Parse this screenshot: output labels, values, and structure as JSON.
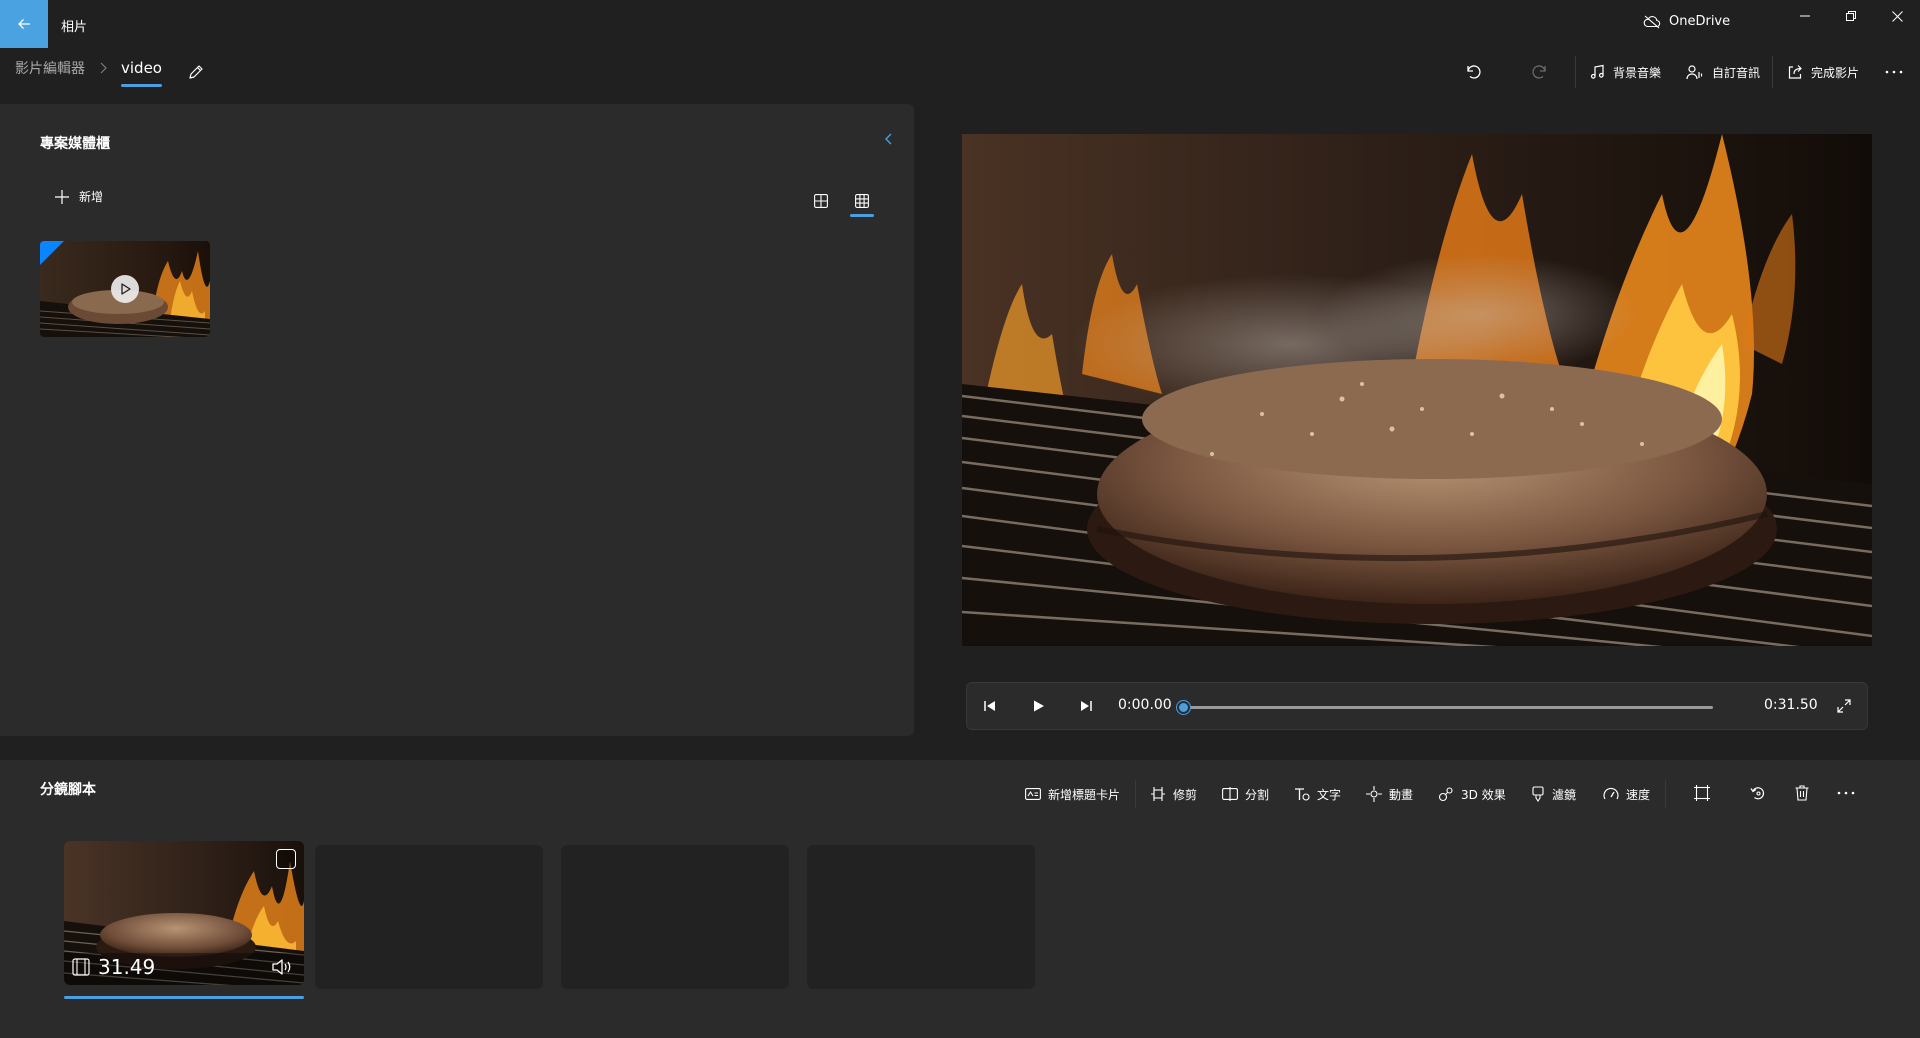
{
  "app": {
    "title": "相片"
  },
  "cloud": {
    "label": "OneDrive"
  },
  "breadcrumb": {
    "root": "影片編輯器",
    "current": "video"
  },
  "toolbar": {
    "background_music": "背景音樂",
    "custom_audio": "自訂音訊",
    "finish_video": "完成影片"
  },
  "library": {
    "title": "專案媒體櫃",
    "add_label": "新增"
  },
  "player": {
    "current_time": "0:00.00",
    "total_time": "0:31.50",
    "progress": 0
  },
  "storyboard": {
    "title": "分鏡腳本",
    "tools": {
      "add_title_card": "新增標題卡片",
      "trim": "修剪",
      "split": "分割",
      "text": "文字",
      "motion": "動畫",
      "effects_3d": "3D 效果",
      "filters": "濾鏡",
      "speed": "速度"
    },
    "clips": [
      {
        "duration": "31.49"
      }
    ]
  },
  "colors": {
    "accent": "#4a9fe0",
    "back_button": "#4aa3e0",
    "background": "#202020",
    "panel": "#2b2b2b"
  }
}
